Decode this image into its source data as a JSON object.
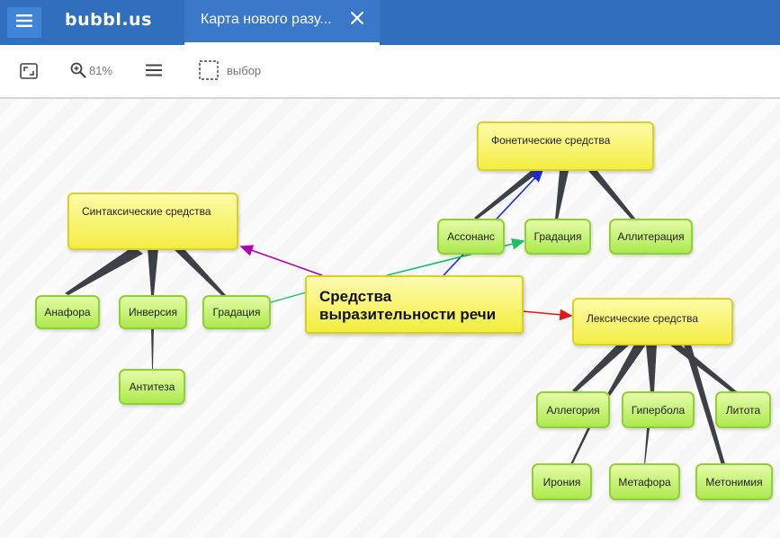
{
  "app": {
    "logo": "bubbl.us",
    "doc_tab_title": "Карта нового разу..."
  },
  "toolbar": {
    "zoom_label": "81%",
    "select_label": "выбор"
  },
  "mindmap": {
    "central": "Средства выразительности речи",
    "synt": "Синтаксические средства",
    "phon": "Фонетические средства",
    "lex": "Лексические средства",
    "anafora": "Анафора",
    "inversia": "Инверсия",
    "gradacia_left": "Градация",
    "antiteza": "Антитеза",
    "assonans": "Ассонанс",
    "gradacia_right": "Градация",
    "alliteracia": "Аллитерация",
    "allegoria": "Аллегория",
    "giperbola": "Гипербола",
    "litota": "Литота",
    "ironia": "Ирония",
    "metafora": "Метафора",
    "metonimia": "Метонимия"
  },
  "colors": {
    "header": "#2f6fbe",
    "arrow_synt": "#b000b0",
    "arrow_phon": "#1a2bd8",
    "arrow_lex": "#e01818",
    "arrow_grad": "#18c060",
    "branch": "#3d4047"
  }
}
